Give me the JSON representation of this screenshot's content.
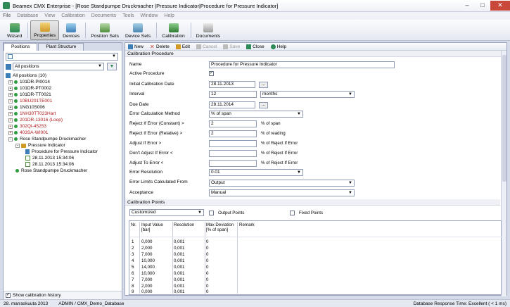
{
  "window": {
    "title": "Beamex CMX Enterprise - [Rose Standpumpe Druckmacher |Pressure Indicator|Procedure for Pressure Indicator]",
    "min": "–",
    "max": "□",
    "close": "✕"
  },
  "menu": [
    "File",
    "Database",
    "View",
    "Calibration",
    "Documents",
    "Tools",
    "Window",
    "Help"
  ],
  "toolbar": [
    "Wizard",
    "Properties",
    "Devices",
    "Position Sets",
    "Device Sets",
    "Calibration",
    "Documents"
  ],
  "left": {
    "tabs": [
      "Positions",
      "Plant Structure"
    ],
    "filter": "All positions",
    "tree": [
      {
        "label": "All positions (10)",
        "level": 0,
        "red": false
      },
      {
        "label": "101DR-PI0014",
        "level": 1,
        "red": false
      },
      {
        "label": "101DR-PT0002",
        "level": 1,
        "red": false
      },
      {
        "label": "101DR-TT0021",
        "level": 1,
        "red": false
      },
      {
        "label": "10BU201TE001",
        "level": 1,
        "red": true
      },
      {
        "label": "1NG10S006",
        "level": 1,
        "red": false
      },
      {
        "label": "1NH30TT023Hart",
        "level": 1,
        "red": true
      },
      {
        "label": "201DR-13016 (Loop)",
        "level": 1,
        "red": true
      },
      {
        "label": "302QI-45253",
        "level": 1,
        "red": true
      },
      {
        "label": "403SA-WI001",
        "level": 1,
        "red": true
      },
      {
        "label": "Rose Standpumpe Druckmacher",
        "level": 1,
        "red": false
      },
      {
        "label": "Pressure Indicator",
        "level": 2,
        "red": false
      },
      {
        "label": "Procedure for Pressure Indicator",
        "level": 3,
        "red": false
      },
      {
        "label": "28.11.2013 15:34:06",
        "level": 4,
        "red": false
      },
      {
        "label": "28.11.2013 15:34:06",
        "level": 4,
        "red": false
      },
      {
        "label": "Rose Standpumpe Druckmacher",
        "level": 2,
        "red": false
      }
    ],
    "history": "Show calibration history"
  },
  "actions": [
    "New",
    "Delete",
    "Edit",
    "Cancel",
    "Save",
    "Close",
    "Help"
  ],
  "form": {
    "section": "Calibration Procedure",
    "name_label": "Name",
    "name_value": "Procedure for Pressure Indicator",
    "active_label": "Active Procedure",
    "init_label": "Initial Calibration Date",
    "init_value": "28.11.2013",
    "interval_label": "Interval",
    "interval_value": "12",
    "interval_unit": "months",
    "due_label": "Due Date",
    "due_value": "28.11.2014",
    "ecm_label": "Error Calculation Method",
    "ecm_value": "% of span",
    "rc_label": "Reject If Error (Constant) >",
    "rc_value": "2",
    "rc_unit": "% of span",
    "rr_label": "Reject If Error (Relative) >",
    "rr_value": "2",
    "rr_unit": "% of reading",
    "adj_label": "Adjust If Error >",
    "adj_unit": "% of Reject If Error",
    "dadj_label": "Don't Adjust If Error <",
    "dadj_unit": "% of Reject If Error",
    "adjto_label": "Adjust To Error <",
    "adjto_unit": "% of Reject If Error",
    "res_label": "Error Resolution",
    "res_value": "0.01",
    "elc_label": "Error Limits Calculated From",
    "elc_value": "Output",
    "acc_label": "Acceptance",
    "acc_value": "Manual",
    "points_section": "Calibration Points",
    "points_mode": "Customized",
    "output_points": "Output Points",
    "fixed_points": "Fixed Points"
  },
  "grid": {
    "headers": [
      "Nr.",
      "Input Value [bar]",
      "Resolution",
      "Max Deviation [% of span]",
      "Remark"
    ],
    "rows": [
      [
        "1",
        "0,000",
        "0,001",
        "0"
      ],
      [
        "2",
        "2,000",
        "0,001",
        "0"
      ],
      [
        "3",
        "7,000",
        "0,001",
        "0"
      ],
      [
        "4",
        "10,000",
        "0,001",
        "0"
      ],
      [
        "5",
        "14,000",
        "0,001",
        "0"
      ],
      [
        "6",
        "10,000",
        "0,001",
        "0"
      ],
      [
        "7",
        "7,000",
        "0,001",
        "0"
      ],
      [
        "8",
        "2,000",
        "0,001",
        "0"
      ],
      [
        "9",
        "0,000",
        "0,001",
        "0"
      ]
    ]
  },
  "status": {
    "date": "28. marraskuuta 2013",
    "user": "ADMIN / CMX_Demo_Database",
    "response": "Database Response Time: Excellent ( < 1 ms)"
  },
  "colors": {
    "accent": "#2e8b57",
    "error_red": "#b01818",
    "bg": "#d6dbe9"
  }
}
